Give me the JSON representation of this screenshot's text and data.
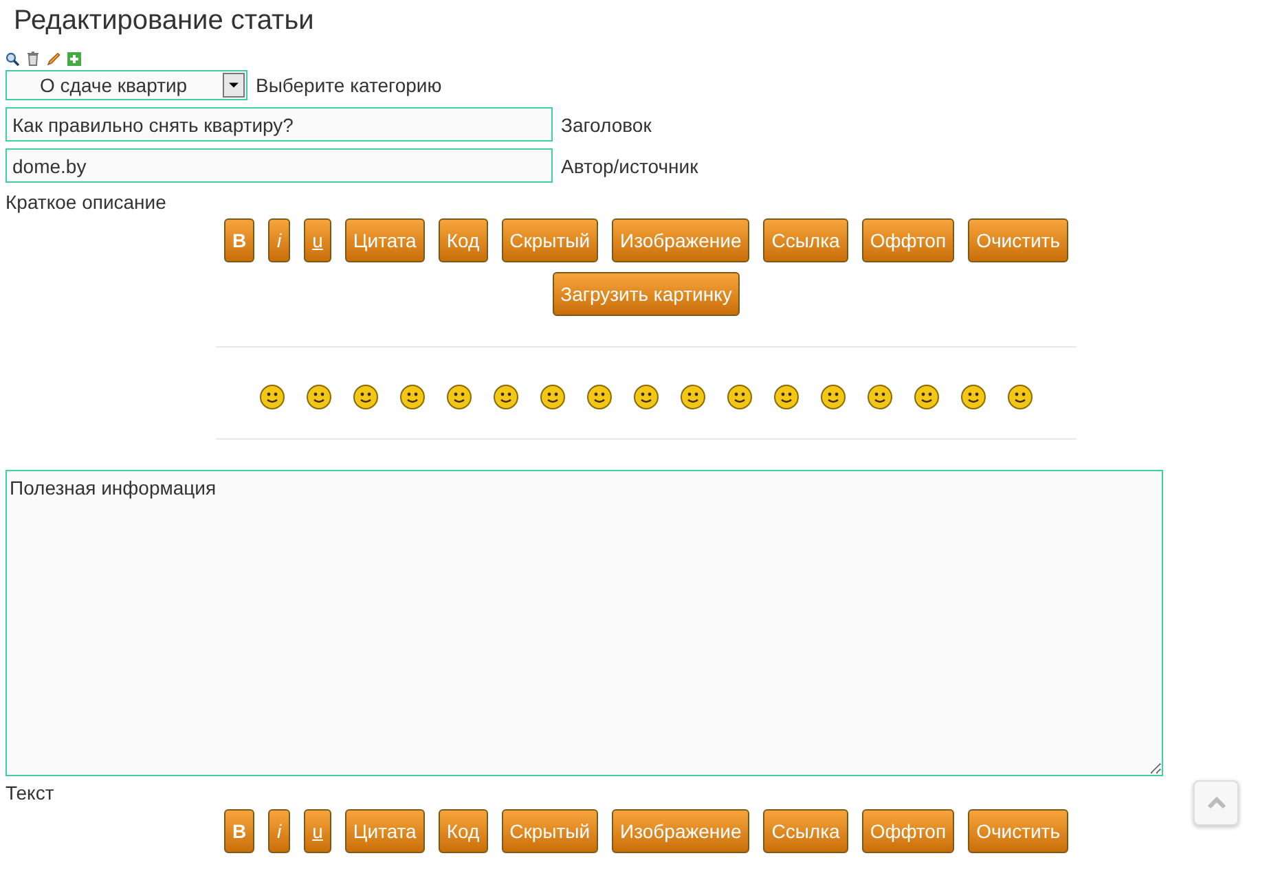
{
  "title": "Редактирование статьи",
  "category": {
    "value": "О сдаче квартир",
    "label": "Выберите категорию"
  },
  "heading_field": {
    "value": "Как правильно снять квартиру?",
    "label": "Заголовок"
  },
  "author_field": {
    "value": "dome.by",
    "label": "Автор/источник"
  },
  "summary_label": "Краткое описание",
  "summary_toolbar": [
    {
      "label": "B",
      "kind": "bold"
    },
    {
      "label": "i",
      "kind": "italic"
    },
    {
      "label": "u",
      "kind": "underline"
    },
    {
      "label": "Цитата",
      "kind": "plain"
    },
    {
      "label": "Код",
      "kind": "plain"
    },
    {
      "label": "Скрытый",
      "kind": "plain"
    },
    {
      "label": "Изображение",
      "kind": "plain"
    },
    {
      "label": "Ссылка",
      "kind": "plain"
    },
    {
      "label": "Оффтоп",
      "kind": "plain"
    },
    {
      "label": "Очистить",
      "kind": "plain"
    }
  ],
  "upload_button": "Загрузить картинку",
  "text_area": {
    "value": "Полезная информация"
  },
  "text_label": "Текст",
  "text_toolbar": [
    {
      "label": "B",
      "kind": "bold"
    },
    {
      "label": "i",
      "kind": "italic"
    },
    {
      "label": "u",
      "kind": "underline"
    },
    {
      "label": "Цитата",
      "kind": "plain"
    },
    {
      "label": "Код",
      "kind": "plain"
    },
    {
      "label": "Скрытый",
      "kind": "plain"
    },
    {
      "label": "Изображение",
      "kind": "plain"
    },
    {
      "label": "Ссылка",
      "kind": "plain"
    },
    {
      "label": "Оффтоп",
      "kind": "plain"
    },
    {
      "label": "Очистить",
      "kind": "plain"
    }
  ]
}
